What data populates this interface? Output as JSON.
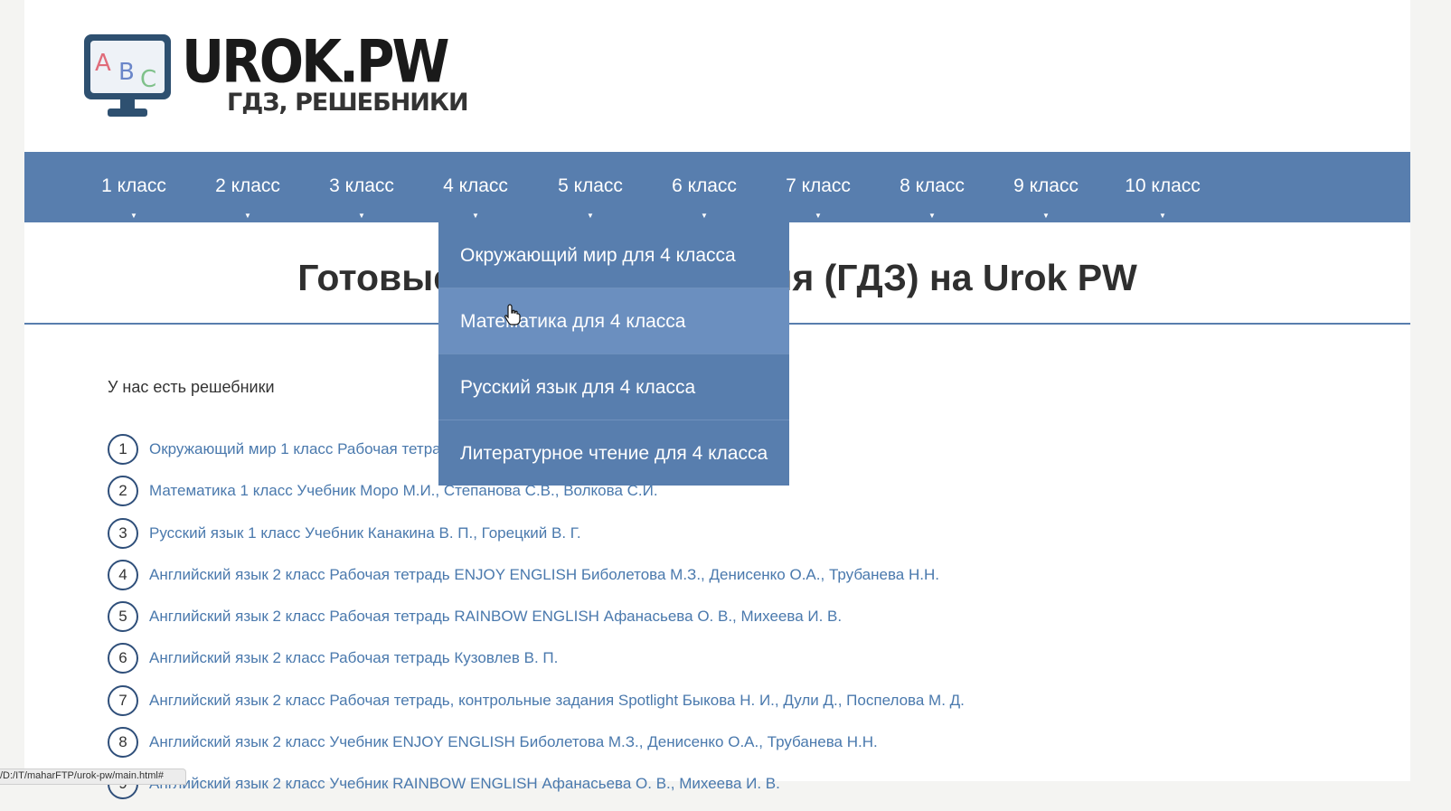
{
  "logo": {
    "title": "UROK.PW",
    "subtitle": "ГДЗ, РЕШЕБНИКИ",
    "monitor_letters": [
      "A",
      "B",
      "C"
    ]
  },
  "nav": {
    "items": [
      {
        "label": "1 класс"
      },
      {
        "label": "2 класс"
      },
      {
        "label": "3 класс"
      },
      {
        "label": "4 класс"
      },
      {
        "label": "5 класс"
      },
      {
        "label": "6 класс"
      },
      {
        "label": "7 класс"
      },
      {
        "label": "8 класс"
      },
      {
        "label": "9 класс"
      },
      {
        "label": "10 класс"
      }
    ],
    "caret": "▼"
  },
  "dropdown": {
    "items": [
      {
        "label": "Окружающий мир для 4 класса"
      },
      {
        "label": "Математика для 4 класса"
      },
      {
        "label": "Русский язык для 4 класса"
      },
      {
        "label": "Литературное чтение для 4 класса"
      }
    ]
  },
  "main": {
    "heading": "Готовые домашние задания (ГДЗ) на Urok PW",
    "intro": "У нас есть решебники",
    "list": [
      {
        "num": "1",
        "text": "Окружающий мир 1 класс Рабочая тетрадь Плешаков А.А."
      },
      {
        "num": "2",
        "text": "Математика 1 класс Учебник Моро М.И., Степанова С.В., Волкова С.И."
      },
      {
        "num": "3",
        "text": "Русский язык 1 класс Учебник Канакина В. П., Горецкий В. Г."
      },
      {
        "num": "4",
        "text": "Английский язык 2 класс Рабочая тетрадь ENJOY ENGLISH Биболетова М.З., Денисенко О.А., Трубанева Н.Н."
      },
      {
        "num": "5",
        "text": "Английский язык 2 класс Рабочая тетрадь RAINBOW ENGLISH Афанасьева О. В., Михеева И. В."
      },
      {
        "num": "6",
        "text": "Английский язык 2 класс Рабочая тетрадь Кузовлев В. П."
      },
      {
        "num": "7",
        "text": "Английский язык 2 класс Рабочая тетрадь, контрольные задания Spotlight Быкова Н. И., Дули Д., Поспелова М. Д."
      },
      {
        "num": "8",
        "text": "Английский язык 2 класс Учебник ENJOY ENGLISH Биболетова М.З., Денисенко О.А., Трубанева Н.Н."
      },
      {
        "num": "9",
        "text": "Английский язык 2 класс Учебник RAINBOW ENGLISH Афанасьева О. В., Михеева И. В."
      }
    ]
  },
  "statusbar": {
    "url": "/D:/IT/maharFTP/urok-pw/main.html#"
  },
  "colors": {
    "nav_bg": "#587eae",
    "dropdown_hover": "#6b8fbf",
    "link": "#4a79ad",
    "heading": "#2f2f2f"
  }
}
